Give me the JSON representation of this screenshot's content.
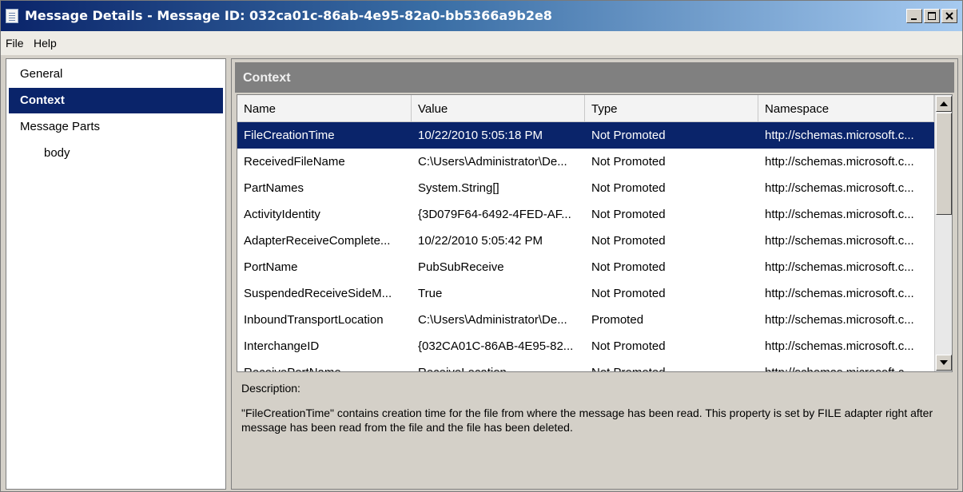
{
  "window": {
    "title": "Message Details - Message ID: 032ca01c-86ab-4e95-82a0-bb5366a9b2e8",
    "icon": "document-icon"
  },
  "menu": {
    "items": [
      "File",
      "Help"
    ]
  },
  "nav": {
    "items": [
      {
        "label": "General",
        "selected": false,
        "level": 0
      },
      {
        "label": "Context",
        "selected": true,
        "level": 0
      },
      {
        "label": "Message Parts",
        "selected": false,
        "level": 0
      },
      {
        "label": "body",
        "selected": false,
        "level": 1
      }
    ]
  },
  "context": {
    "header": "Context",
    "columns": [
      "Name",
      "Value",
      "Type",
      "Namespace"
    ],
    "rows": [
      [
        "FileCreationTime",
        "10/22/2010 5:05:18 PM",
        "Not Promoted",
        "http://schemas.microsoft.c..."
      ],
      [
        "ReceivedFileName",
        "C:\\Users\\Administrator\\De...",
        "Not Promoted",
        "http://schemas.microsoft.c..."
      ],
      [
        "PartNames",
        "System.String[]",
        "Not Promoted",
        "http://schemas.microsoft.c..."
      ],
      [
        "ActivityIdentity",
        "{3D079F64-6492-4FED-AF...",
        "Not Promoted",
        "http://schemas.microsoft.c..."
      ],
      [
        "AdapterReceiveComplete...",
        "10/22/2010 5:05:42 PM",
        "Not Promoted",
        "http://schemas.microsoft.c..."
      ],
      [
        "PortName",
        "PubSubReceive",
        "Not Promoted",
        "http://schemas.microsoft.c..."
      ],
      [
        "SuspendedReceiveSideM...",
        "True",
        "Not Promoted",
        "http://schemas.microsoft.c..."
      ],
      [
        "InboundTransportLocation",
        "C:\\Users\\Administrator\\De...",
        "Promoted",
        "http://schemas.microsoft.c..."
      ],
      [
        "InterchangeID",
        "{032CA01C-86AB-4E95-82...",
        "Not Promoted",
        "http://schemas.microsoft.c..."
      ],
      [
        "ReceivePortName",
        "ReceiveLocation...",
        "Not Promoted",
        "http://schemas.microsoft.c..."
      ]
    ],
    "selected_row": 0
  },
  "description": {
    "label": "Description:",
    "text": "\"FileCreationTime\" contains creation time for the file from where the message has been read. This property is set by FILE adapter right after message has been read from the file and the file has been deleted."
  },
  "colors": {
    "selection": "#0a246a",
    "panel": "#d4d0c8",
    "header_bar": "#808080"
  }
}
